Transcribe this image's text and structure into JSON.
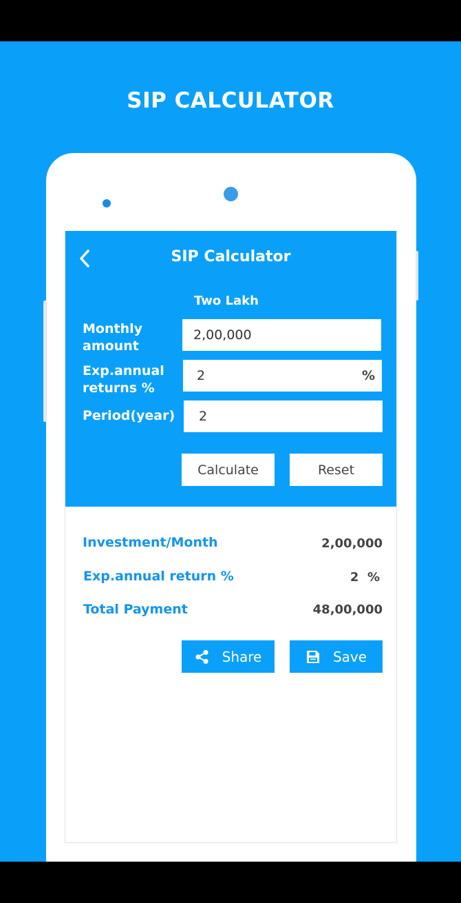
{
  "promo": {
    "title": "SIP CALCULATOR"
  },
  "app": {
    "title": "SIP Calculator"
  },
  "form": {
    "amount_hint": "Two Lakh",
    "monthly_label_1": "Monthly",
    "monthly_label_2": "amount",
    "monthly_value": "2,00,000",
    "returns_label_1": "Exp.annual",
    "returns_label_2": "returns %",
    "returns_value": "2",
    "returns_suffix": "%",
    "period_label": "Period(year)",
    "period_value": "2",
    "calculate_label": "Calculate",
    "reset_label": "Reset"
  },
  "results": {
    "investment_label": "Investment/Month",
    "investment_value": "2,00,000",
    "return_label": "Exp.annual return %",
    "return_value": "2  %",
    "total_label": "Total Payment",
    "total_value": "48,00,000"
  },
  "actions": {
    "share_label": "Share",
    "save_label": "Save"
  },
  "colors": {
    "accent": "#0aa0fa",
    "result_label": "#1495ea"
  }
}
